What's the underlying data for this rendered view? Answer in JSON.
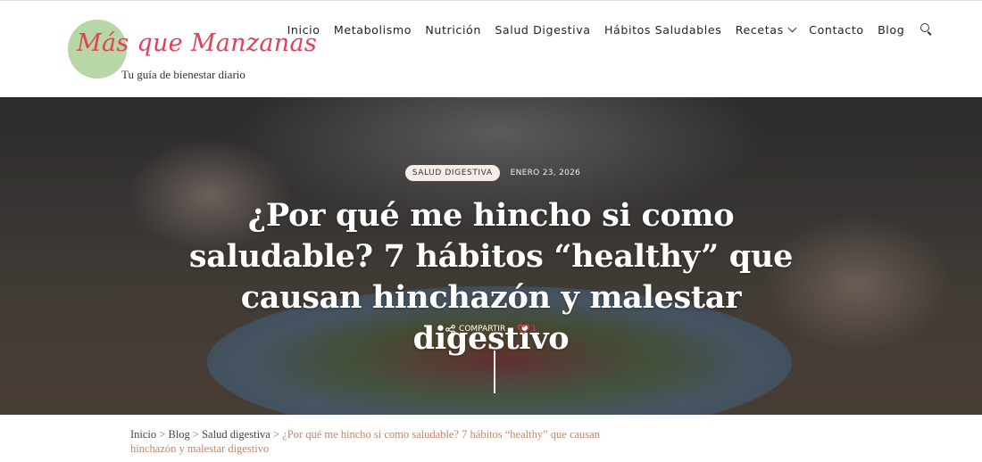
{
  "brand": {
    "name": "Más que Manzanas",
    "tagline": "Tu guía de bienestar diario",
    "logo_color": "#e2405b",
    "logo_circle_color": "#b9d6a6"
  },
  "nav": {
    "items": [
      {
        "label": "Inicio"
      },
      {
        "label": "Metabolismo"
      },
      {
        "label": "Nutrición"
      },
      {
        "label": "Salud Digestiva"
      },
      {
        "label": "Hábitos Saludables"
      },
      {
        "label": "Recetas",
        "has_dropdown": true
      },
      {
        "label": "Contacto"
      },
      {
        "label": "Blog"
      }
    ],
    "search_icon": "search-icon"
  },
  "post": {
    "category": "SALUD DIGESTIVA",
    "date": "ENERO 23, 2026",
    "title": "¿Por qué me hincho si como saludable? 7 hábitos “healthy” que causan hinchazón y malestar digestivo",
    "share_label": "COMPARTIR",
    "likes": "1",
    "like_color": "#e23a4f"
  },
  "breadcrumb": {
    "items": [
      "Inicio",
      "Blog",
      "Salud digestiva"
    ],
    "separator": ">",
    "current": "¿Por qué me hincho si como saludable? 7 hábitos “healthy” que causan hinchazón y malestar digestivo",
    "current_color": "#c0876a"
  }
}
